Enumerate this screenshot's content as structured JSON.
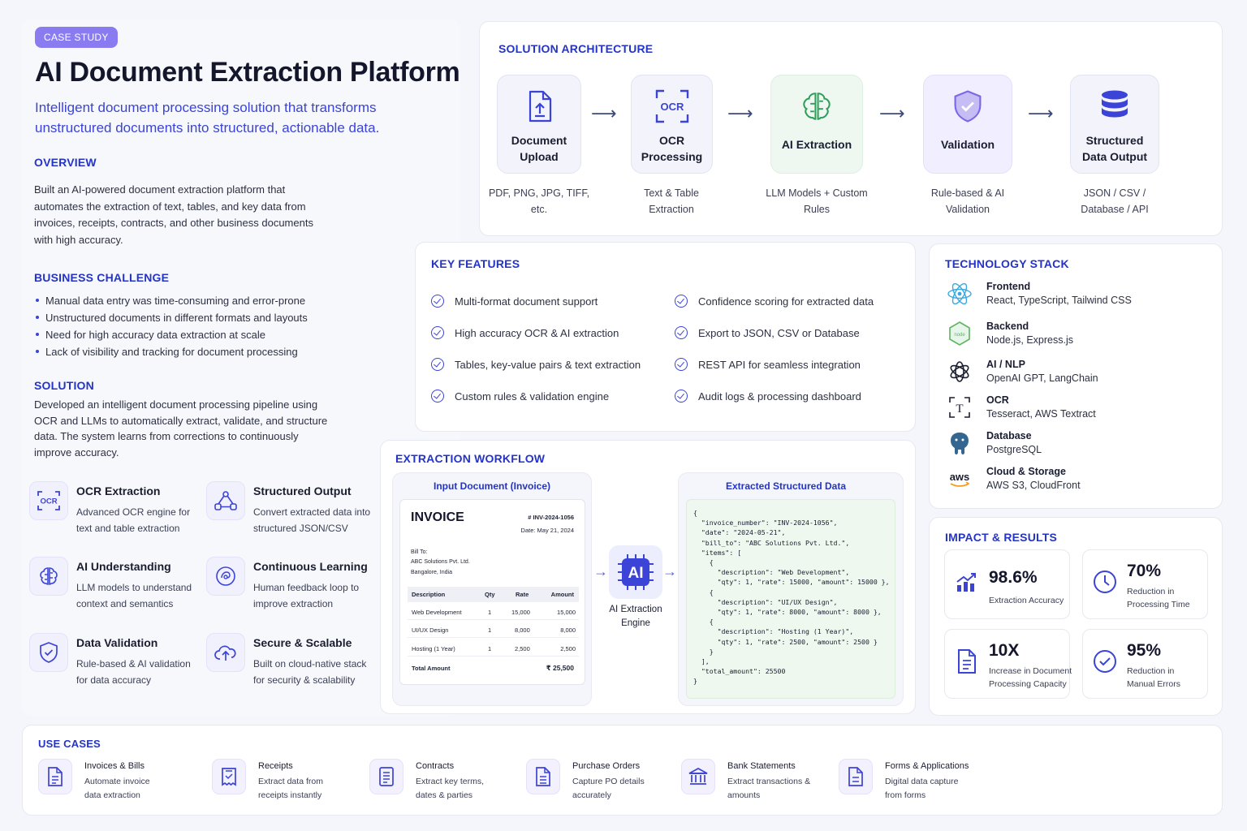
{
  "badge": "CASE STUDY",
  "title": "AI Document Extraction Platform",
  "subtitle": "Intelligent document processing solution that transforms unstructured documents into structured, actionable data.",
  "overview": {
    "heading": "OVERVIEW",
    "text": "Built an AI-powered document extraction platform that automates the extraction of text, tables, and key data from invoices, receipts, contracts, and other business documents with high accuracy."
  },
  "challenge": {
    "heading": "BUSINESS CHALLENGE",
    "items": [
      "Manual data entry was time-consuming and error-prone",
      "Unstructured documents in different formats and layouts",
      "Need for high accuracy data extraction at scale",
      "Lack of visibility and tracking for document processing"
    ]
  },
  "solution": {
    "heading": "SOLUTION",
    "text": "Developed an intelligent document processing pipeline using OCR and LLMs to automatically extract, validate, and structure data. The system learns from corrections to continuously improve accuracy."
  },
  "features": [
    {
      "title": "OCR Extraction",
      "desc": "Advanced OCR engine for text and table extraction",
      "icon": "ocr-icon"
    },
    {
      "title": "Structured Output",
      "desc": "Convert extracted data into structured JSON/CSV",
      "icon": "structure-icon"
    },
    {
      "title": "AI Understanding",
      "desc": "LLM models to understand context and semantics",
      "icon": "brain-icon"
    },
    {
      "title": "Continuous Learning",
      "desc": "Human feedback loop to improve extraction",
      "icon": "learning-icon"
    },
    {
      "title": "Data Validation",
      "desc": "Rule-based & AI validation for data accuracy",
      "icon": "shield-check-icon"
    },
    {
      "title": "Secure & Scalable",
      "desc": "Built on cloud-native stack for security & scalability",
      "icon": "cloud-upload-icon"
    }
  ],
  "architecture": {
    "heading": "SOLUTION ARCHITECTURE",
    "steps": [
      {
        "label": "Document Upload",
        "sub": "PDF, PNG, JPG, TIFF, etc.",
        "icon": "upload-file-icon",
        "bg": "#f3f4fb"
      },
      {
        "label": "OCR Processing",
        "sub": "Text & Table Extraction",
        "icon": "ocr-scan-icon",
        "bg": "#f3f4fb"
      },
      {
        "label": "AI Extraction",
        "sub": "LLM Models + Custom Rules",
        "icon": "brain-icon",
        "bg": "#eef8f1"
      },
      {
        "label": "Validation",
        "sub": "Rule-based & AI Validation",
        "icon": "shield-check-icon",
        "bg": "#f1efff"
      },
      {
        "label": "Structured Data Output",
        "sub": "JSON / CSV / Database / API",
        "icon": "database-icon",
        "bg": "#f3f4fb"
      }
    ]
  },
  "key_features": {
    "heading": "KEY FEATURES",
    "left": [
      "Multi-format document support",
      "High accuracy OCR & AI extraction",
      "Tables, key-value pairs & text extraction",
      "Custom rules & validation engine"
    ],
    "right": [
      "Confidence scoring for extracted data",
      "Export to JSON, CSV or Database",
      "REST API for seamless integration",
      "Audit logs & processing dashboard"
    ]
  },
  "tech_stack": {
    "heading": "TECHNOLOGY STACK",
    "items": [
      {
        "name": "Frontend",
        "value": "React, TypeScript, Tailwind CSS",
        "icon": "react-icon"
      },
      {
        "name": "Backend",
        "value": "Node.js, Express.js",
        "icon": "nodejs-icon"
      },
      {
        "name": "AI / NLP",
        "value": "OpenAI GPT, LangChain",
        "icon": "openai-icon"
      },
      {
        "name": "OCR",
        "value": "Tesseract, AWS Textract",
        "icon": "text-scan-icon"
      },
      {
        "name": "Database",
        "value": "PostgreSQL",
        "icon": "postgresql-icon"
      },
      {
        "name": "Cloud & Storage",
        "value": "AWS S3, CloudFront",
        "icon": "aws-icon"
      }
    ]
  },
  "workflow": {
    "heading": "EXTRACTION WORKFLOW",
    "input_title": "Input Document (Invoice)",
    "output_title": "Extracted Structured Data",
    "engine_label": "AI Extraction Engine",
    "engine_icon_text": "AI",
    "invoice": {
      "title": "INVOICE",
      "number": "# INV-2024-1056",
      "date": "Date: May 21, 2024",
      "bill_to_label": "Bill To:",
      "bill_to_name": "ABC Solutions Pvt. Ltd.",
      "bill_to_city": "Bangalore, India",
      "columns": [
        "Description",
        "Qty",
        "Rate",
        "Amount"
      ],
      "rows": [
        [
          "Web Development",
          "1",
          "15,000",
          "15,000"
        ],
        [
          "UI/UX Design",
          "1",
          "8,000",
          "8,000"
        ],
        [
          "Hosting (1 Year)",
          "1",
          "2,500",
          "2,500"
        ]
      ],
      "total_label": "Total Amount",
      "total_value": "₹ 25,500"
    },
    "json_lines": [
      "{",
      "  \"invoice_number\": \"INV-2024-1056\",",
      "  \"date\": \"2024-05-21\",",
      "  \"bill_to\": \"ABC Solutions Pvt. Ltd.\",",
      "  \"items\": [",
      "    {",
      "      \"description\": \"Web Development\",",
      "      \"qty\": 1, \"rate\": 15000, \"amount\": 15000 },",
      "    {",
      "      \"description\": \"UI/UX Design\",",
      "      \"qty\": 1, \"rate\": 8000, \"amount\": 8000 },",
      "    {",
      "      \"description\": \"Hosting (1 Year)\",",
      "      \"qty\": 1, \"rate\": 2500, \"amount\": 2500 }",
      "    }",
      "  ],",
      "  \"total_amount\": 25500",
      "}"
    ]
  },
  "impact": {
    "heading": "IMPACT & RESULTS",
    "items": [
      {
        "value": "98.6%",
        "label": "Extraction Accuracy",
        "icon": "chart-up-icon"
      },
      {
        "value": "70%",
        "label": "Reduction in Processing Time",
        "icon": "clock-icon"
      },
      {
        "value": "10X",
        "label": "Increase in Document Processing Capacity",
        "icon": "document-icon"
      },
      {
        "value": "95%",
        "label": "Reduction in Manual Errors",
        "icon": "check-circle-icon"
      }
    ]
  },
  "use_cases": {
    "heading": "USE CASES",
    "items": [
      {
        "name": "Invoices & Bills",
        "desc": "Automate invoice data extraction",
        "icon": "invoice-icon"
      },
      {
        "name": "Receipts",
        "desc": "Extract data from receipts instantly",
        "icon": "receipt-icon"
      },
      {
        "name": "Contracts",
        "desc": "Extract key terms, dates & parties",
        "icon": "contract-icon"
      },
      {
        "name": "Purchase Orders",
        "desc": "Capture PO details accurately",
        "icon": "purchase-order-icon"
      },
      {
        "name": "Bank Statements",
        "desc": "Extract transactions & amounts",
        "icon": "bank-icon"
      },
      {
        "name": "Forms & Applications",
        "desc": "Digital data capture from forms",
        "icon": "form-icon"
      }
    ]
  }
}
